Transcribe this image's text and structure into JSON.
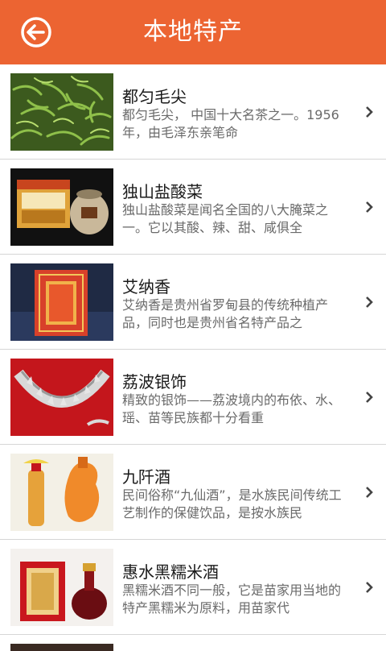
{
  "header": {
    "title": "本地特产",
    "back_icon": "back-arrow-icon",
    "color": "#ec6432"
  },
  "items": [
    {
      "name": "都匀毛尖",
      "desc": "都匀毛尖， 中国十大名茶之一。1956年，由毛泽东亲笔命",
      "image": "green-tea-leaves"
    },
    {
      "name": "独山盐酸菜",
      "desc": "独山盐酸菜是闻名全国的八大腌菜之一。它以其酸、辣、甜、咸俱全",
      "image": "pickle-gift-box-and-jar"
    },
    {
      "name": "艾纳香",
      "desc": "艾纳香是贵州省罗甸县的传统种植产品，同时也是贵州省名特产品之",
      "image": "red-product-box"
    },
    {
      "name": "荔波银饰",
      "desc": "精致的银饰——荔波境内的布依、水、瑶、苗等民族都十分看重",
      "image": "silver-necklace"
    },
    {
      "name": "九阡酒",
      "desc": "民间俗称“九仙酒”，是水族民间传统工艺制作的保健饮品，是按水族民",
      "image": "liquor-bottles"
    },
    {
      "name": "惠水黑糯米酒",
      "desc": "黑糯米酒不同一般，它是苗家用当地的特产黑糯米为原料，用苗家代",
      "image": "rice-wine-box-and-bottle"
    }
  ]
}
